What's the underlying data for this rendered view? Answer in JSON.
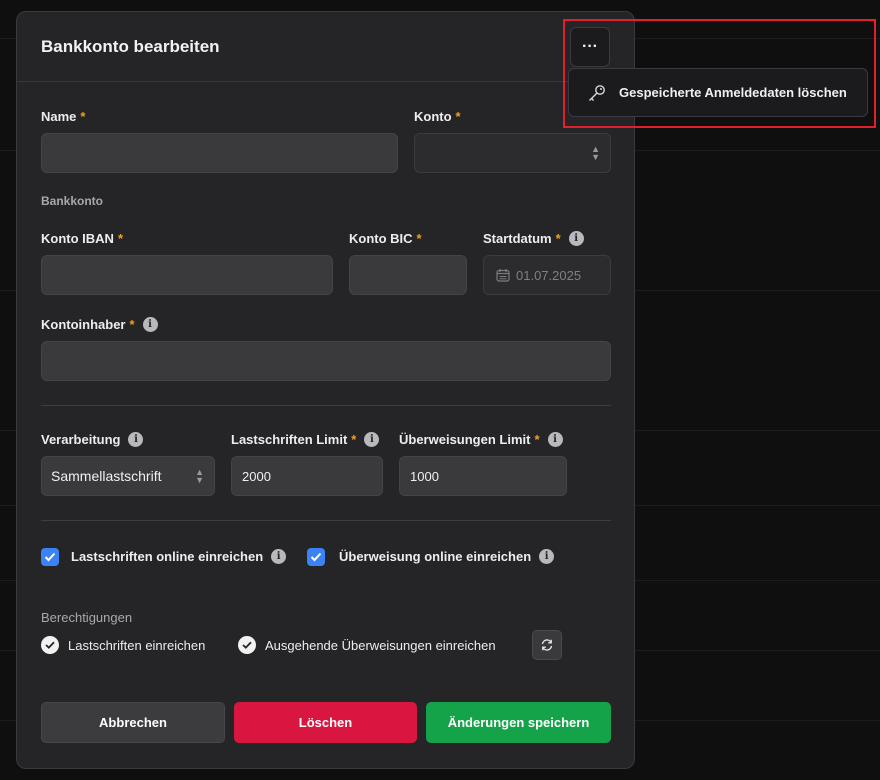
{
  "modal": {
    "title": "Bankkonto bearbeiten"
  },
  "fields": {
    "name": {
      "label": "Name",
      "value": ""
    },
    "konto": {
      "label": "Konto",
      "value": ""
    },
    "section_bankkonto": "Bankkonto",
    "iban": {
      "label": "Konto IBAN",
      "value": ""
    },
    "bic": {
      "label": "Konto BIC",
      "value": ""
    },
    "startdatum": {
      "label": "Startdatum",
      "value": "01.07.2025"
    },
    "kontoinhaber": {
      "label": "Kontoinhaber",
      "value": ""
    },
    "verarbeitung": {
      "label": "Verarbeitung",
      "value": "Sammellastschrift"
    },
    "lastschriften_limit": {
      "label": "Lastschriften Limit",
      "value": "2000"
    },
    "ueberweisungen_limit": {
      "label": "Überweisungen Limit",
      "value": "1000"
    }
  },
  "required_marker": "*",
  "info_glyph": "i",
  "checkboxes": [
    {
      "label": "Lastschriften online einreichen",
      "checked": true
    },
    {
      "label": "Überweisung online einreichen",
      "checked": true
    }
  ],
  "permissions": {
    "title": "Berechtigungen",
    "items": [
      "Lastschriften einreichen",
      "Ausgehende Überweisungen einreichen"
    ]
  },
  "buttons": {
    "cancel": "Abbrechen",
    "delete": "Löschen",
    "save": "Änderungen speichern"
  },
  "menu": {
    "more_label": "···",
    "items": [
      {
        "label": "Gespeicherte Anmeldedaten löschen",
        "icon": "key-icon"
      }
    ]
  },
  "colors": {
    "accent_required": "#f0a020",
    "checkbox": "#3b82f6",
    "delete": "#d9163f",
    "save": "#15a34a",
    "highlight": "#e0202a"
  }
}
